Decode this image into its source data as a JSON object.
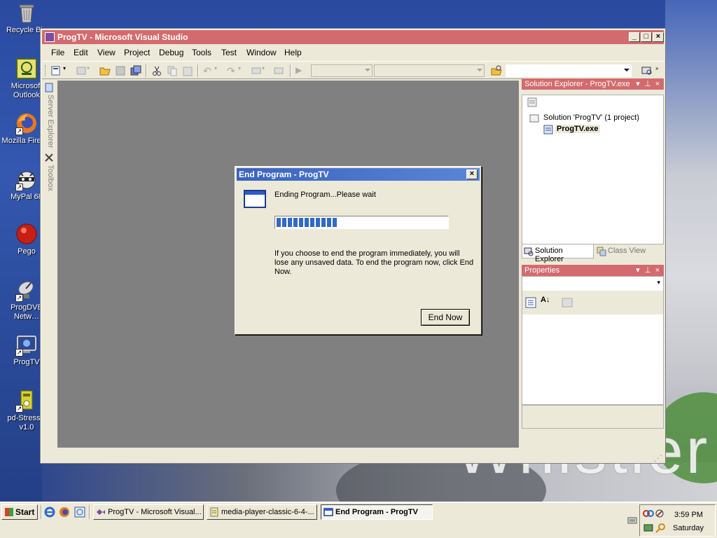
{
  "desktop": {
    "wallpaper_text": "Whistler",
    "icons": [
      {
        "label": "Recycle Bin",
        "name": "recycle-bin"
      },
      {
        "label": "Microsoft Outlook",
        "name": "outlook"
      },
      {
        "label": "Mozilla Firefox",
        "name": "firefox"
      },
      {
        "label": "MyPal 68",
        "name": "mypal"
      },
      {
        "label": "Pego",
        "name": "pego"
      },
      {
        "label": "ProgDVB Netw…",
        "name": "progdvb"
      },
      {
        "label": "ProgTV",
        "name": "progtv"
      },
      {
        "label": "pd-StressR v1.0",
        "name": "pd-stressr"
      }
    ]
  },
  "vs": {
    "title": "ProgTV - Microsoft Visual Studio",
    "menu": [
      "File",
      "Edit",
      "View",
      "Project",
      "Debug",
      "Tools",
      "Test",
      "Window",
      "Help"
    ],
    "side_tabs": [
      "Server Explorer",
      "Toolbox"
    ],
    "solution_explorer": {
      "title": "Solution Explorer - ProgTV.exe",
      "solution": "Solution 'ProgTV' (1 project)",
      "project": "ProgTV.exe",
      "tab_solution": "Solution Explorer",
      "tab_class": "Class View"
    },
    "properties": {
      "title": "Properties"
    }
  },
  "dialog": {
    "title": "End Program - ProgTV",
    "status": "Ending Program...Please wait",
    "progress": 0.36,
    "message": "If you choose to end the program immediately, you will lose any unsaved data. To end the program now, click End Now.",
    "end_now_label": "End Now"
  },
  "taskbar": {
    "start_label": "Start",
    "tasks": [
      {
        "label": "ProgTV - Microsoft Visual...",
        "active": false
      },
      {
        "label": "media-player-classic-6-4-...",
        "active": false
      },
      {
        "label": "End Program - ProgTV",
        "active": true
      }
    ],
    "clock_time": "3:59 PM",
    "clock_day": "Saturday"
  },
  "colors": {
    "vs_title": "#d36b6e",
    "dialog_title": "#3a63c0",
    "progress_fill": "#316ac5"
  }
}
